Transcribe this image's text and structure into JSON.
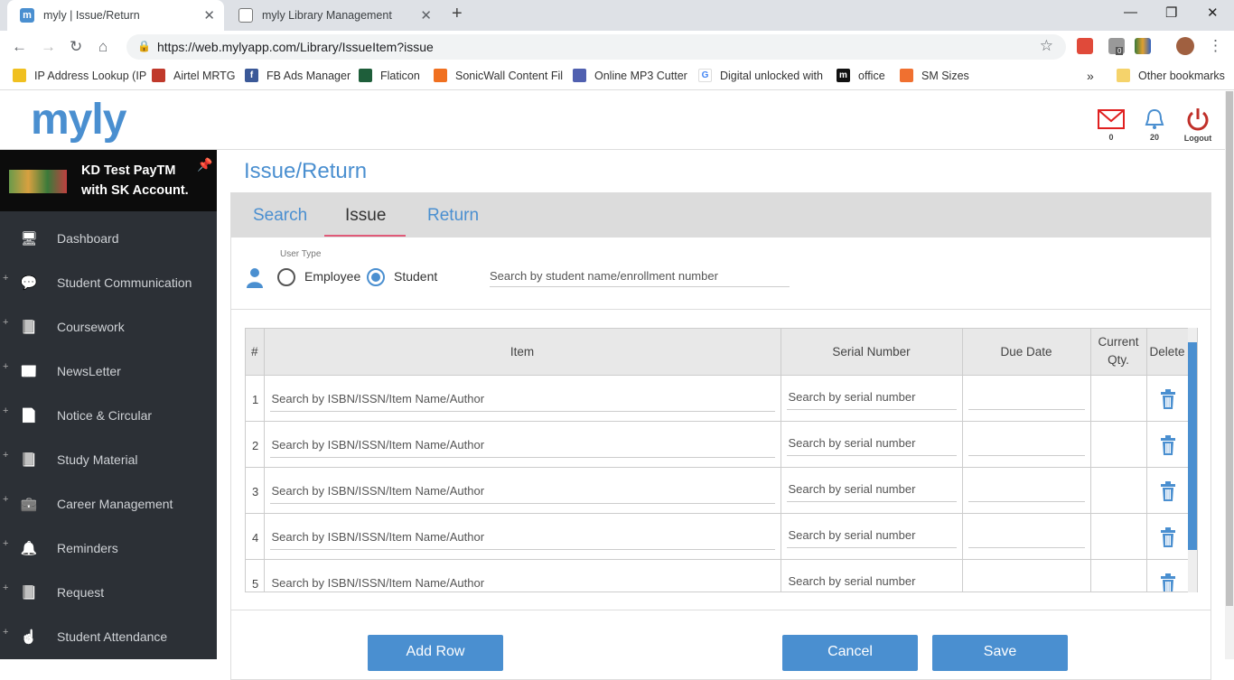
{
  "browser": {
    "tabs": [
      {
        "title": "myly | Issue/Return",
        "favicon": "m"
      },
      {
        "title": "myly Library Management",
        "favicon": "page-icon"
      }
    ],
    "url": "https://web.mylyapp.com/Library/IssueItem?issue",
    "ext_badge": "0",
    "bookmarks": [
      "IP Address Lookup (IP",
      "Airtel MRTG",
      "FB Ads Manager",
      "Flaticon",
      "SonicWall Content Fil",
      "Online MP3 Cutter",
      "Digital unlocked with",
      "office",
      "SM Sizes"
    ],
    "overflow": "»",
    "other_bookmarks": "Other bookmarks"
  },
  "app": {
    "logo": "myly",
    "mail_count": "0",
    "notif_count": "20",
    "logout": "Logout"
  },
  "sidebar": {
    "account": "KD Test PayTM with SK Account.",
    "items": [
      {
        "label": "Dashboard",
        "icon": "monitor-icon",
        "expand": false
      },
      {
        "label": "Student Communication",
        "icon": "chat-icon",
        "expand": true
      },
      {
        "label": "Coursework",
        "icon": "book-icon",
        "expand": true
      },
      {
        "label": "NewsLetter",
        "icon": "newspaper-icon",
        "expand": true
      },
      {
        "label": "Notice & Circular",
        "icon": "document-icon",
        "expand": true
      },
      {
        "label": "Study Material",
        "icon": "book-icon",
        "expand": true
      },
      {
        "label": "Career Management",
        "icon": "briefcase-icon",
        "expand": true
      },
      {
        "label": "Reminders",
        "icon": "bell-icon",
        "expand": true
      },
      {
        "label": "Request",
        "icon": "book-icon",
        "expand": true
      },
      {
        "label": "Student Attendance",
        "icon": "hand-icon",
        "expand": true
      }
    ]
  },
  "page": {
    "title": "Issue/Return",
    "tabs": [
      "Search",
      "Issue",
      "Return"
    ],
    "active_tab": "Issue",
    "user_type_label": "User Type",
    "user_types": [
      "Employee",
      "Student"
    ],
    "selected_user_type": "Student",
    "student_search_placeholder": "Search by student name/enrollment number",
    "table": {
      "headers": [
        "#",
        "Item",
        "Serial Number",
        "Due Date",
        "Current Qty.",
        "Delete"
      ],
      "rows": [
        {
          "n": "1",
          "item": "Search by ISBN/ISSN/Item Name/Author",
          "serial": "Search by serial number"
        },
        {
          "n": "2",
          "item": "Search by ISBN/ISSN/Item Name/Author",
          "serial": "Search by serial number"
        },
        {
          "n": "3",
          "item": "Search by ISBN/ISSN/Item Name/Author",
          "serial": "Search by serial number"
        },
        {
          "n": "4",
          "item": "Search by ISBN/ISSN/Item Name/Author",
          "serial": "Search by serial number"
        },
        {
          "n": "5",
          "item": "Search by ISBN/ISSN/Item Name/Author",
          "serial": "Search by serial number"
        }
      ]
    },
    "buttons": {
      "add_row": "Add Row",
      "cancel": "Cancel",
      "save": "Save"
    }
  }
}
